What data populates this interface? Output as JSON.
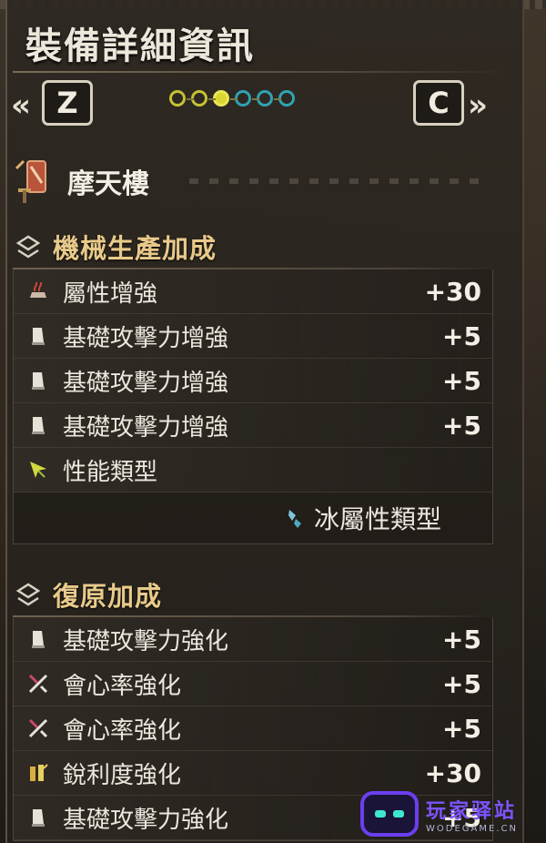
{
  "header": {
    "title": "裝備詳細資訊",
    "prev_key": "Z",
    "next_key": "C",
    "prev_arrow": "«",
    "next_arrow": "»",
    "page_dots": [
      "yellow",
      "yellow",
      "yellow-current",
      "teal",
      "teal",
      "teal"
    ]
  },
  "weapon": {
    "name": "摩天樓",
    "icon": "great-sword-icon"
  },
  "sections": [
    {
      "title": "機械生產加成",
      "rows": [
        {
          "icon": "element-boost-icon",
          "label": "屬性增強",
          "value": "+30"
        },
        {
          "icon": "attack-boost-icon",
          "label": "基礎攻擊力增強",
          "value": "+5"
        },
        {
          "icon": "attack-boost-icon",
          "label": "基礎攻擊力增強",
          "value": "+5"
        },
        {
          "icon": "attack-boost-icon",
          "label": "基礎攻擊力增強",
          "value": "+5"
        },
        {
          "icon": "performance-type-icon",
          "label": "性能類型",
          "value": ""
        }
      ],
      "sub_row": {
        "icon": "ice-element-icon",
        "label": "冰屬性類型"
      }
    },
    {
      "title": "復原加成",
      "rows": [
        {
          "icon": "attack-boost-icon",
          "label": "基礎攻擊力強化",
          "value": "+5"
        },
        {
          "icon": "affinity-icon",
          "label": "會心率強化",
          "value": "+5"
        },
        {
          "icon": "affinity-icon",
          "label": "會心率強化",
          "value": "+5"
        },
        {
          "icon": "sharpness-icon",
          "label": "銳利度強化",
          "value": "+30"
        },
        {
          "icon": "attack-boost-icon",
          "label": "基礎攻擊力強化",
          "value": "+5"
        }
      ]
    }
  ],
  "watermark": {
    "main": "玩家驿站",
    "sub": "WODEGAME.CN"
  },
  "colors": {
    "section_title": "#e8ca8a",
    "dot_yellow": "#c6c233",
    "dot_teal": "#2fa3b3",
    "watermark": "#7d54ff"
  }
}
